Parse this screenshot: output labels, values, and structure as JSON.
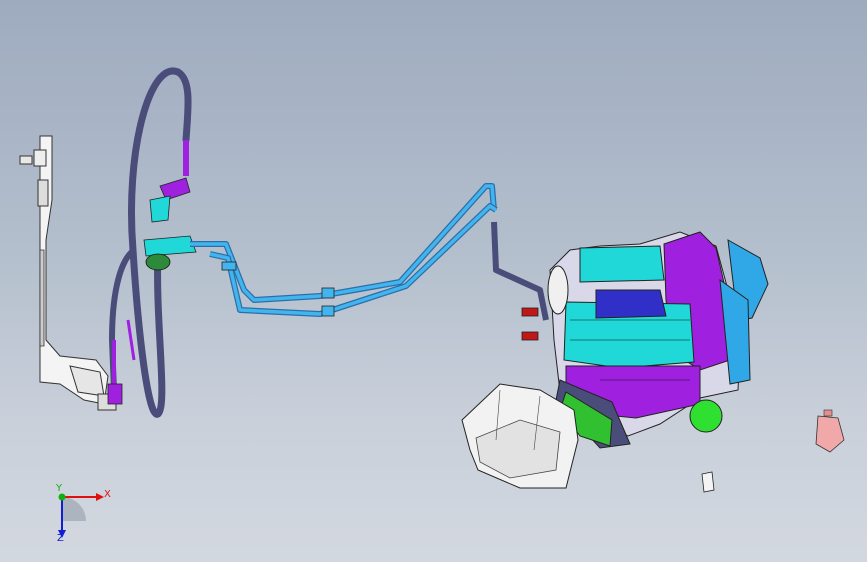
{
  "viewport": {
    "background_top": "#9eabbf",
    "background_bottom": "#d3d8e0"
  },
  "triad": {
    "x_label": "X",
    "y_label": "Y",
    "z_label": "Z",
    "x_color": "#e01010",
    "y_color": "#10b010",
    "z_color": "#1020d0"
  },
  "colors": {
    "tube_dark": "#4a4d7a",
    "tube_light": "#3aa0e0",
    "purple": "#a020e0",
    "cyan": "#20d8d8",
    "green": "#30e030",
    "red": "#c01818",
    "white_part": "#f2f2f2",
    "pink_part": "#f0a8a8"
  },
  "icons": {
    "triad": "axis-triad-icon"
  }
}
